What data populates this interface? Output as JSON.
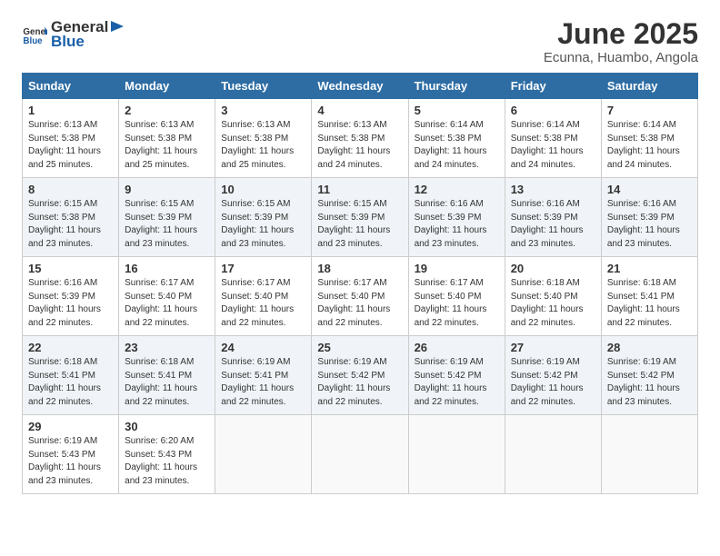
{
  "logo": {
    "text_general": "General",
    "text_blue": "Blue"
  },
  "header": {
    "title": "June 2025",
    "subtitle": "Ecunna, Huambo, Angola"
  },
  "weekdays": [
    "Sunday",
    "Monday",
    "Tuesday",
    "Wednesday",
    "Thursday",
    "Friday",
    "Saturday"
  ],
  "weeks": [
    [
      {
        "day": "1",
        "info": "Sunrise: 6:13 AM\nSunset: 5:38 PM\nDaylight: 11 hours and 25 minutes."
      },
      {
        "day": "2",
        "info": "Sunrise: 6:13 AM\nSunset: 5:38 PM\nDaylight: 11 hours and 25 minutes."
      },
      {
        "day": "3",
        "info": "Sunrise: 6:13 AM\nSunset: 5:38 PM\nDaylight: 11 hours and 25 minutes."
      },
      {
        "day": "4",
        "info": "Sunrise: 6:13 AM\nSunset: 5:38 PM\nDaylight: 11 hours and 24 minutes."
      },
      {
        "day": "5",
        "info": "Sunrise: 6:14 AM\nSunset: 5:38 PM\nDaylight: 11 hours and 24 minutes."
      },
      {
        "day": "6",
        "info": "Sunrise: 6:14 AM\nSunset: 5:38 PM\nDaylight: 11 hours and 24 minutes."
      },
      {
        "day": "7",
        "info": "Sunrise: 6:14 AM\nSunset: 5:38 PM\nDaylight: 11 hours and 24 minutes."
      }
    ],
    [
      {
        "day": "8",
        "info": "Sunrise: 6:15 AM\nSunset: 5:38 PM\nDaylight: 11 hours and 23 minutes."
      },
      {
        "day": "9",
        "info": "Sunrise: 6:15 AM\nSunset: 5:39 PM\nDaylight: 11 hours and 23 minutes."
      },
      {
        "day": "10",
        "info": "Sunrise: 6:15 AM\nSunset: 5:39 PM\nDaylight: 11 hours and 23 minutes."
      },
      {
        "day": "11",
        "info": "Sunrise: 6:15 AM\nSunset: 5:39 PM\nDaylight: 11 hours and 23 minutes."
      },
      {
        "day": "12",
        "info": "Sunrise: 6:16 AM\nSunset: 5:39 PM\nDaylight: 11 hours and 23 minutes."
      },
      {
        "day": "13",
        "info": "Sunrise: 6:16 AM\nSunset: 5:39 PM\nDaylight: 11 hours and 23 minutes."
      },
      {
        "day": "14",
        "info": "Sunrise: 6:16 AM\nSunset: 5:39 PM\nDaylight: 11 hours and 23 minutes."
      }
    ],
    [
      {
        "day": "15",
        "info": "Sunrise: 6:16 AM\nSunset: 5:39 PM\nDaylight: 11 hours and 22 minutes."
      },
      {
        "day": "16",
        "info": "Sunrise: 6:17 AM\nSunset: 5:40 PM\nDaylight: 11 hours and 22 minutes."
      },
      {
        "day": "17",
        "info": "Sunrise: 6:17 AM\nSunset: 5:40 PM\nDaylight: 11 hours and 22 minutes."
      },
      {
        "day": "18",
        "info": "Sunrise: 6:17 AM\nSunset: 5:40 PM\nDaylight: 11 hours and 22 minutes."
      },
      {
        "day": "19",
        "info": "Sunrise: 6:17 AM\nSunset: 5:40 PM\nDaylight: 11 hours and 22 minutes."
      },
      {
        "day": "20",
        "info": "Sunrise: 6:18 AM\nSunset: 5:40 PM\nDaylight: 11 hours and 22 minutes."
      },
      {
        "day": "21",
        "info": "Sunrise: 6:18 AM\nSunset: 5:41 PM\nDaylight: 11 hours and 22 minutes."
      }
    ],
    [
      {
        "day": "22",
        "info": "Sunrise: 6:18 AM\nSunset: 5:41 PM\nDaylight: 11 hours and 22 minutes."
      },
      {
        "day": "23",
        "info": "Sunrise: 6:18 AM\nSunset: 5:41 PM\nDaylight: 11 hours and 22 minutes."
      },
      {
        "day": "24",
        "info": "Sunrise: 6:19 AM\nSunset: 5:41 PM\nDaylight: 11 hours and 22 minutes."
      },
      {
        "day": "25",
        "info": "Sunrise: 6:19 AM\nSunset: 5:42 PM\nDaylight: 11 hours and 22 minutes."
      },
      {
        "day": "26",
        "info": "Sunrise: 6:19 AM\nSunset: 5:42 PM\nDaylight: 11 hours and 22 minutes."
      },
      {
        "day": "27",
        "info": "Sunrise: 6:19 AM\nSunset: 5:42 PM\nDaylight: 11 hours and 22 minutes."
      },
      {
        "day": "28",
        "info": "Sunrise: 6:19 AM\nSunset: 5:42 PM\nDaylight: 11 hours and 23 minutes."
      }
    ],
    [
      {
        "day": "29",
        "info": "Sunrise: 6:19 AM\nSunset: 5:43 PM\nDaylight: 11 hours and 23 minutes."
      },
      {
        "day": "30",
        "info": "Sunrise: 6:20 AM\nSunset: 5:43 PM\nDaylight: 11 hours and 23 minutes."
      },
      null,
      null,
      null,
      null,
      null
    ]
  ]
}
